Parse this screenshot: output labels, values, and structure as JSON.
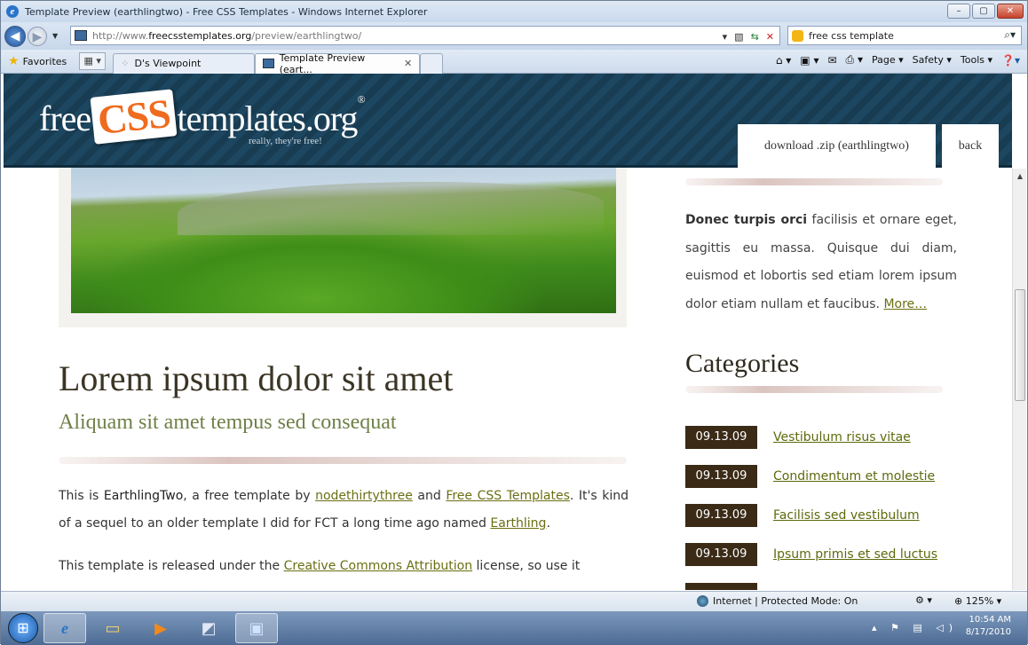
{
  "window": {
    "title": "Template Preview (earthlingtwo) - Free CSS Templates - Windows Internet Explorer"
  },
  "address": {
    "prefix": "http://www.",
    "domain": "freecsstemplates.org",
    "path": "/preview/earthlingtwo/"
  },
  "search": {
    "value": "free css template"
  },
  "favorites_label": "Favorites",
  "tabs": [
    {
      "label": "D's Viewpoint"
    },
    {
      "label": "Template Preview (eart..."
    }
  ],
  "commands": {
    "page": "Page",
    "safety": "Safety",
    "tools": "Tools"
  },
  "site": {
    "logo_free": "free",
    "logo_css": "CSS",
    "logo_templates": "templates.org",
    "logo_reg": "®",
    "tagline": "really, they're free!",
    "download_label": "download .zip (earthlingtwo)",
    "back_label": "back"
  },
  "main": {
    "title": "Lorem ipsum dolor sit amet",
    "subtitle": "Aliquam sit amet tempus sed consequat",
    "p1": {
      "t1": "This is ",
      "b1": "EarthlingTwo",
      "t2": ", a free template by ",
      "l1": "nodethirtythree",
      "t3": " and ",
      "l2": "Free CSS Templates",
      "t4": ". It's kind of a sequel to an older template I did for FCT a long time ago named ",
      "l3": "Earthling",
      "t5": "."
    },
    "p2": {
      "t1": "This template is released under the ",
      "l1": "Creative Commons Attribution",
      "t2": " license, so use it"
    }
  },
  "sidebar": {
    "intro_bold": "Donec turpis orci",
    "intro_text": " facilisis et ornare eget, sagittis eu massa. Quisque dui diam, euismod et lobortis sed etiam lorem ipsum dolor etiam nullam et faucibus. ",
    "more_label": "More…",
    "categories_title": "Categories",
    "categories": [
      {
        "date": "09.13.09",
        "label": "Vestibulum risus vitae"
      },
      {
        "date": "09.13.09",
        "label": "Condimentum et molestie"
      },
      {
        "date": "09.13.09",
        "label": "Facilisis sed vestibulum"
      },
      {
        "date": "09.13.09",
        "label": "Ipsum primis et sed luctus"
      }
    ]
  },
  "status": {
    "zone": "Internet | Protected Mode: On",
    "zoom": "125%"
  },
  "clock": {
    "time": "10:54 AM",
    "date": "8/17/2010"
  }
}
